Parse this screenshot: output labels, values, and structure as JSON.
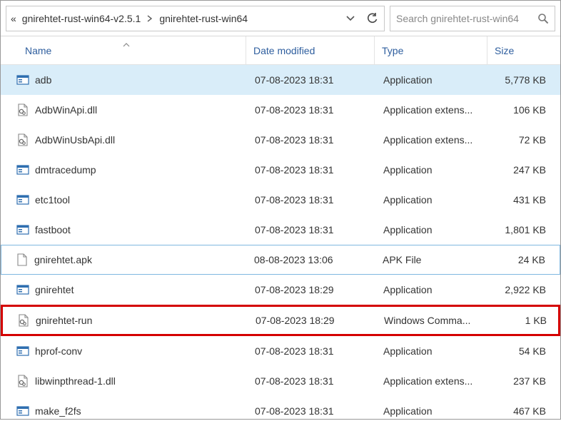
{
  "breadcrumb": {
    "truncated_indicator": "«",
    "segments": [
      "gnirehtet-rust-win64-v2.5.1",
      "gnirehtet-rust-win64"
    ]
  },
  "search": {
    "placeholder": "Search gnirehtet-rust-win64"
  },
  "columns": {
    "name": "Name",
    "date": "Date modified",
    "type": "Type",
    "size": "Size"
  },
  "rows": [
    {
      "icon": "exe",
      "name": "adb",
      "date": "07-08-2023 18:31",
      "type": "Application",
      "size": "5,778 KB",
      "state": "selected"
    },
    {
      "icon": "dll",
      "name": "AdbWinApi.dll",
      "date": "07-08-2023 18:31",
      "type": "Application extens...",
      "size": "106 KB",
      "state": ""
    },
    {
      "icon": "dll",
      "name": "AdbWinUsbApi.dll",
      "date": "07-08-2023 18:31",
      "type": "Application extens...",
      "size": "72 KB",
      "state": ""
    },
    {
      "icon": "exe",
      "name": "dmtracedump",
      "date": "07-08-2023 18:31",
      "type": "Application",
      "size": "247 KB",
      "state": ""
    },
    {
      "icon": "exe",
      "name": "etc1tool",
      "date": "07-08-2023 18:31",
      "type": "Application",
      "size": "431 KB",
      "state": ""
    },
    {
      "icon": "exe",
      "name": "fastboot",
      "date": "07-08-2023 18:31",
      "type": "Application",
      "size": "1,801 KB",
      "state": ""
    },
    {
      "icon": "doc",
      "name": "gnirehtet.apk",
      "date": "08-08-2023 13:06",
      "type": "APK File",
      "size": "24 KB",
      "state": "focused"
    },
    {
      "icon": "exe",
      "name": "gnirehtet",
      "date": "07-08-2023 18:29",
      "type": "Application",
      "size": "2,922 KB",
      "state": ""
    },
    {
      "icon": "bat",
      "name": "gnirehtet-run",
      "date": "07-08-2023 18:29",
      "type": "Windows Comma...",
      "size": "1 KB",
      "state": "highlight"
    },
    {
      "icon": "exe",
      "name": "hprof-conv",
      "date": "07-08-2023 18:31",
      "type": "Application",
      "size": "54 KB",
      "state": ""
    },
    {
      "icon": "dll",
      "name": "libwinpthread-1.dll",
      "date": "07-08-2023 18:31",
      "type": "Application extens...",
      "size": "237 KB",
      "state": ""
    },
    {
      "icon": "exe",
      "name": "make_f2fs",
      "date": "07-08-2023 18:31",
      "type": "Application",
      "size": "467 KB",
      "state": ""
    }
  ]
}
